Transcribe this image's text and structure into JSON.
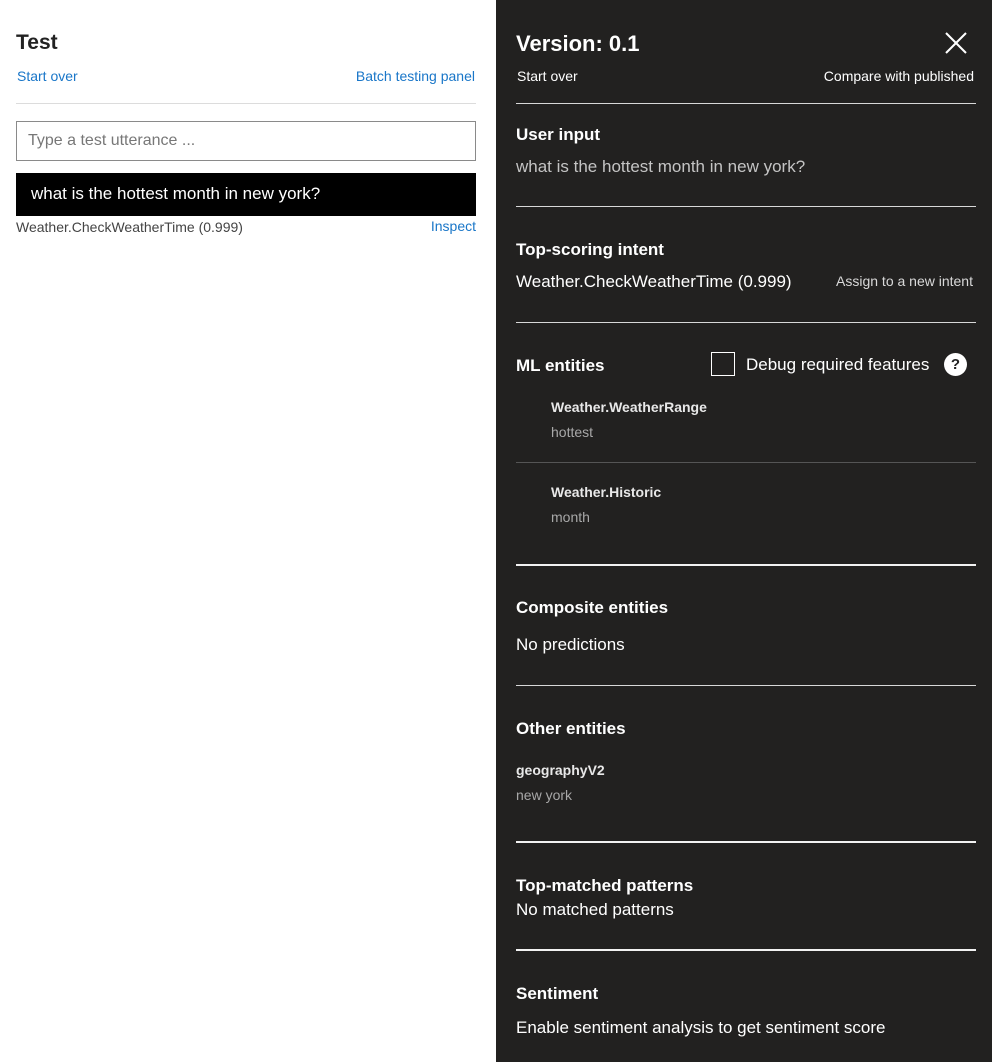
{
  "test_panel": {
    "title": "Test",
    "start_over": "Start over",
    "batch_testing": "Batch testing panel",
    "input_placeholder": "Type a test utterance ...",
    "utterance": "what is the hottest month in new york?",
    "result": "Weather.CheckWeatherTime (0.999)",
    "inspect": "Inspect"
  },
  "inspect_panel": {
    "version_title": "Version: 0.1",
    "close_icon": "close-icon",
    "start_over": "Start over",
    "compare": "Compare with published",
    "user_input": {
      "heading": "User input",
      "value": "what is the hottest month in new york?"
    },
    "top_intent": {
      "heading": "Top-scoring intent",
      "value": "Weather.CheckWeatherTime (0.999)",
      "assign": "Assign to a new intent"
    },
    "ml_entities": {
      "heading": "ML entities",
      "debug_label": "Debug required features",
      "help": "?",
      "items": [
        {
          "name": "Weather.WeatherRange",
          "value": "hottest"
        },
        {
          "name": "Weather.Historic",
          "value": "month"
        }
      ]
    },
    "composite_entities": {
      "heading": "Composite entities",
      "value": "No predictions"
    },
    "other_entities": {
      "heading": "Other entities",
      "items": [
        {
          "name": "geographyV2",
          "value": "new york"
        }
      ]
    },
    "patterns": {
      "heading": "Top-matched patterns",
      "value": "No matched patterns"
    },
    "sentiment": {
      "heading": "Sentiment",
      "value": "Enable sentiment analysis to get sentiment score"
    }
  },
  "colors": {
    "link": "#1976c8",
    "panel_bg": "#222120",
    "utterance_bg": "#000000"
  }
}
